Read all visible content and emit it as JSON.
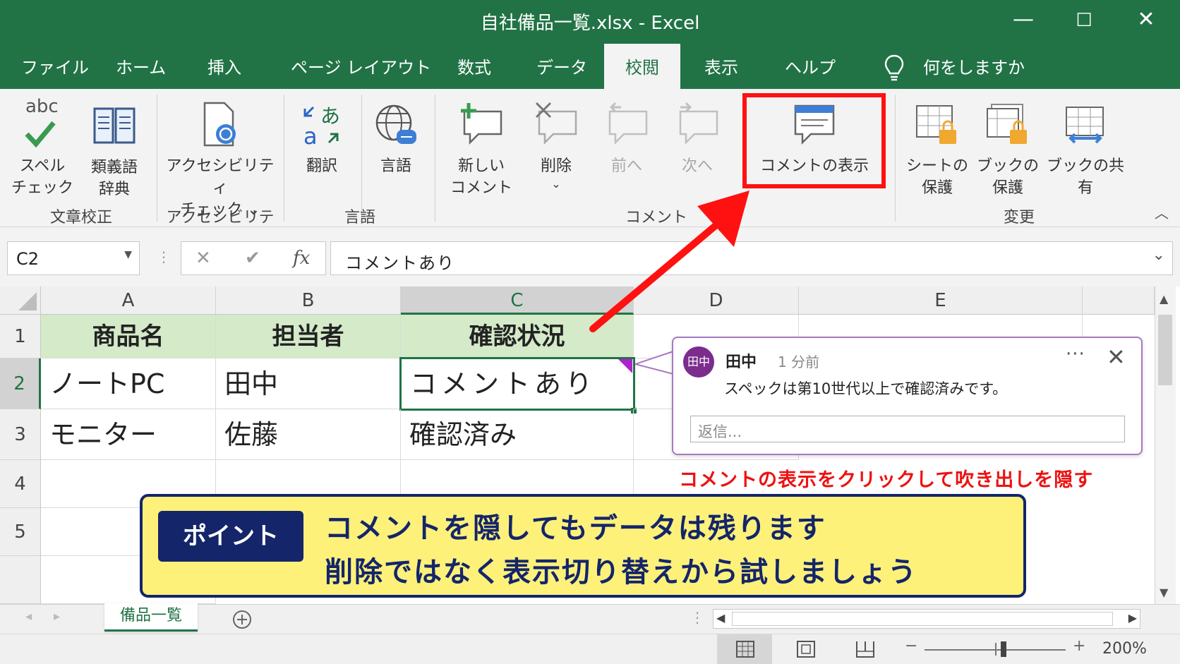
{
  "window": {
    "title": "自社備品一覧.xlsx  -  Excel"
  },
  "tabs": [
    "ファイル",
    "ホーム",
    "挿入",
    "ページ レイアウト",
    "数式",
    "データ",
    "校閲",
    "表示",
    "ヘルプ"
  ],
  "tell_me": "何をしますか",
  "ribbon": {
    "spell_line1": "スペル",
    "spell_line2": "チェック",
    "abc": "abc",
    "thesaurus_line1": "類義語",
    "thesaurus_line2": "辞典",
    "access_line1": "アクセシビリティ",
    "access_line2": "チェック ⌄",
    "translate": "翻訳",
    "language": "言語",
    "new_comment_line1": "新しい",
    "new_comment_line2": "コメント",
    "delete": "削除",
    "delete_dd": "⌄",
    "prev": "前へ",
    "next": "次へ",
    "show_comments": "コメントの表示",
    "protect_sheet_line1": "シートの",
    "protect_sheet_line2": "保護",
    "protect_book_line1": "ブックの",
    "protect_book_line2": "保護",
    "share_book": "ブックの共有",
    "groups": {
      "proofing": "文章校正",
      "accessibility": "アクセシビリティ",
      "language": "言語",
      "comments": "コメント",
      "changes": "変更"
    }
  },
  "formula_bar": {
    "name_box": "C2",
    "fx": "fx",
    "content": "コメントあり"
  },
  "columns": [
    "A",
    "B",
    "C",
    "D",
    "E"
  ],
  "rows": [
    "1",
    "2",
    "3",
    "4",
    "5"
  ],
  "cells": {
    "A1": "商品名",
    "B1": "担当者",
    "C1": "確認状況",
    "A2": "ノートPC",
    "B2": "田中",
    "C2": "コメントあり",
    "A3": "モニター",
    "B3": "佐藤",
    "C3": "確認済み"
  },
  "comment": {
    "avatar": "田中",
    "author": "田中",
    "time": "1 分前",
    "text": "スペックは第10世代以上で確認済みです。",
    "reply_placeholder": "返信..."
  },
  "annotation": "コメントの表示をクリックして吹き出しを隠す",
  "point": {
    "badge": "ポイント",
    "line1": "コメントを隠してもデータは残ります",
    "line2": "削除ではなく表示切り替えから試しましょう"
  },
  "sheet_tab": "備品一覧",
  "zoom": "200%",
  "colors": {
    "excel_green": "#217346",
    "highlight_red": "#ff1111",
    "point_yellow": "#fdf17a",
    "point_navy": "#14256a"
  }
}
